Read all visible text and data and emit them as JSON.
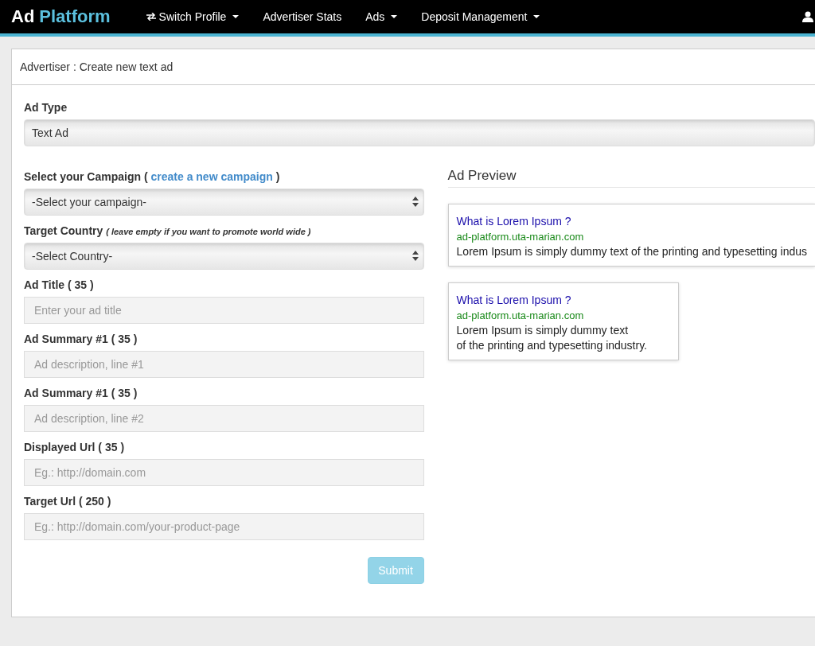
{
  "navbar": {
    "brand_words": [
      "Ad",
      "Platform"
    ],
    "items": [
      {
        "label": "Switch Profile",
        "kind": "profile",
        "caret": true
      },
      {
        "label": "Advertiser Stats",
        "kind": "link",
        "caret": false
      },
      {
        "label": "Ads",
        "kind": "link",
        "caret": true
      },
      {
        "label": "Deposit Management",
        "kind": "link",
        "caret": true
      }
    ]
  },
  "panel": {
    "title": "Advertiser : Create new text ad"
  },
  "ad_type": {
    "label": "Ad Type",
    "value": "Text Ad"
  },
  "fields": [
    {
      "kind": "select",
      "label": "Select your Campaign (",
      "link": "create a new campaign",
      "label_end": ")",
      "value": "-Select your campaign-"
    },
    {
      "kind": "select",
      "label": "Target Country",
      "hint": "( leave empty if you want to promote world wide )",
      "value": "-Select Country-"
    },
    {
      "kind": "input",
      "label": "Ad Title ( 35 )",
      "placeholder": "Enter your ad title"
    },
    {
      "kind": "input",
      "label": "Ad Summary #1 ( 35 )",
      "placeholder": "Ad description, line #1"
    },
    {
      "kind": "input",
      "label": "Ad Summary #1 ( 35 )",
      "placeholder": "Ad description, line #2"
    },
    {
      "kind": "input",
      "label": "Displayed Url ( 35 )",
      "placeholder": "Eg.: http://domain.com"
    },
    {
      "kind": "input",
      "label": "Target Url ( 250 )",
      "placeholder": "Eg.: http://domain.com/your-product-page"
    }
  ],
  "submit": {
    "label": "Submit",
    "disabled": true
  },
  "preview": {
    "title": "Ad Preview",
    "cards": [
      {
        "kind": "wide",
        "title": "What is Lorem Ipsum ?",
        "url": "ad-platform.uta-marian.com",
        "lines": [
          "Lorem Ipsum is simply dummy text of the printing and typesetting indus"
        ]
      },
      {
        "kind": "narrow",
        "title": "What is Lorem Ipsum ?",
        "url": "ad-platform.uta-marian.com",
        "lines": [
          "Lorem Ipsum is simply dummy text",
          "of the printing and typesetting industry."
        ]
      }
    ]
  }
}
